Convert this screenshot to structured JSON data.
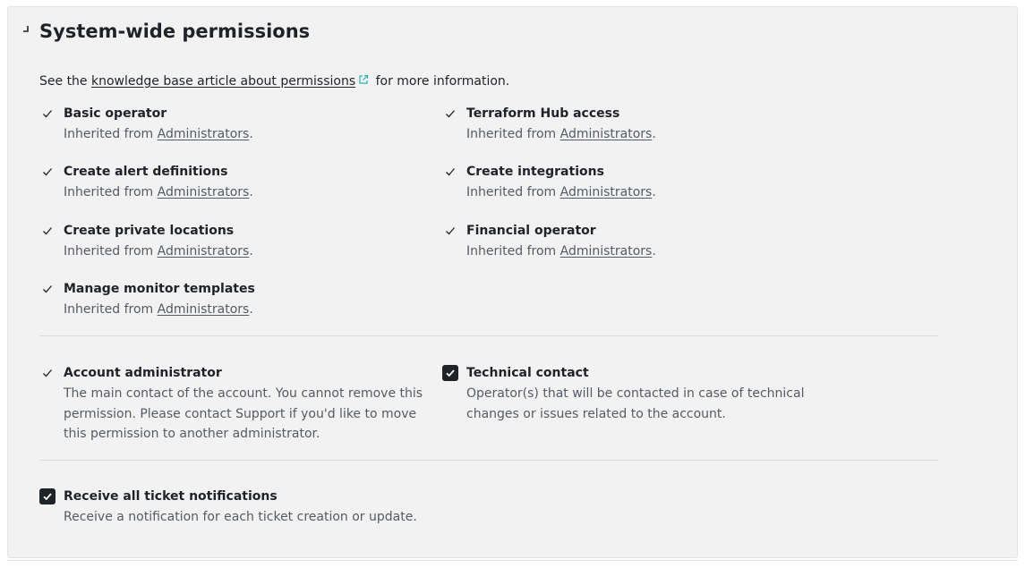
{
  "section": {
    "title": "System-wide permissions",
    "intro_prefix": "See the ",
    "intro_link": "knowledge base article about permissions",
    "intro_suffix": " for more information."
  },
  "inherited": {
    "prefix": "Inherited from ",
    "group": "Administrators",
    "suffix": "."
  },
  "permissions": [
    {
      "title": "Basic operator"
    },
    {
      "title": "Terraform Hub access"
    },
    {
      "title": "Create alert definitions"
    },
    {
      "title": "Create integrations"
    },
    {
      "title": "Create private locations"
    },
    {
      "title": "Financial operator"
    },
    {
      "title": "Manage monitor templates"
    }
  ],
  "roles": {
    "account_admin": {
      "title": "Account administrator",
      "desc": "The main contact of the account. You cannot remove this permission. Please contact Support if you'd like to move this permission to another administrator."
    },
    "technical_contact": {
      "title": "Technical contact",
      "desc": "Operator(s) that will be contacted in case of technical changes or issues related to the account.",
      "checked": true
    }
  },
  "notifications": {
    "title": "Receive all ticket notifications",
    "desc": "Receive a notification for each ticket creation or update.",
    "checked": true
  },
  "colors": {
    "panel": "#f2f2f2",
    "text": "#1f2328",
    "muted": "#555b62",
    "link_icon": "#2bb3b1",
    "checkbox": "#1f2328"
  },
  "icons": {
    "collapse": "collapse-toggle-icon",
    "check": "check-icon",
    "external": "external-link-icon",
    "checkbox": "checkbox-checked-icon"
  }
}
